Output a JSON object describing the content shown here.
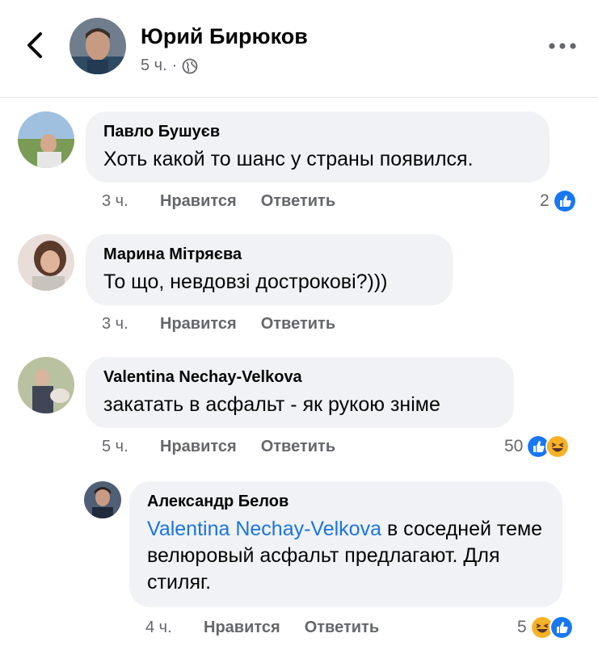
{
  "post": {
    "author": "Юрий Бирюков",
    "time": "5 ч."
  },
  "colors": {
    "like_blue": "#1877f2",
    "haha_yellow": "#f7b125",
    "mention_blue": "#1b74e4",
    "bubble_bg": "#f0f2f5"
  },
  "icons": {
    "back": "chevron-left-icon",
    "more": "more-horizontal-icon",
    "audience": "globe-icon",
    "like": "like-reaction-icon",
    "haha": "haha-reaction-icon"
  },
  "comments": [
    {
      "author": "Павло Бушуєв",
      "text": "Хоть какой то шанс у страны появился.",
      "time": "3 ч.",
      "like_label": "Нравится",
      "reply_label": "Ответить",
      "reactions_count": "2"
    },
    {
      "author": "Марина Мітряєва",
      "text": "То що, невдовзі дострокові?)))",
      "time": "3 ч.",
      "like_label": "Нравится",
      "reply_label": "Ответить"
    },
    {
      "author": "Valentina Nechay-Velkova",
      "text": "закатать в асфальт - як рукою зніме",
      "time": "5 ч.",
      "like_label": "Нравится",
      "reply_label": "Ответить",
      "reactions_count": "50"
    }
  ],
  "reply": {
    "author": "Александр Белов",
    "mention": "Valentina Nechay-Velkova",
    "text": " в соседней теме велюровый асфальт предлагают. Для стиляг.",
    "time": "4 ч.",
    "like_label": "Нравится",
    "reply_label": "Ответить",
    "reactions_count": "5"
  }
}
